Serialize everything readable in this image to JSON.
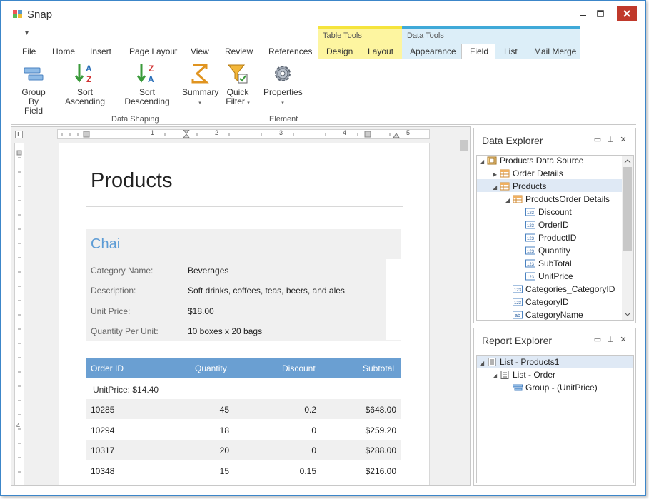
{
  "window": {
    "title": "Snap"
  },
  "ribbon": {
    "qat_arrow": "▾",
    "tabs": [
      "File",
      "Home",
      "Insert",
      "Page Layout",
      "View",
      "Review",
      "References",
      "Design",
      "Layout",
      "Appearance",
      "Field",
      "List",
      "Mail Merge"
    ],
    "active_tab": "Field",
    "context_groups": [
      {
        "label": "Table Tools",
        "color": "#fdf5a0",
        "bar": "#f5e43c"
      },
      {
        "label": "Data Tools",
        "color": "#dceef8",
        "bar": "#3fa9d8"
      }
    ],
    "buttons": [
      {
        "label": "Group By",
        "label2": "Field"
      },
      {
        "label": "Sort Ascending"
      },
      {
        "label": "Sort Descending"
      },
      {
        "label": "Summary",
        "arrow": "▾"
      },
      {
        "label": "Quick",
        "label2": "Filter",
        "arrow": "▾"
      },
      {
        "label": "Properties",
        "arrow": "▾"
      }
    ],
    "groups": [
      "Data Shaping",
      "Element"
    ]
  },
  "document": {
    "title": "Products",
    "product": {
      "name": "Chai",
      "fields": [
        {
          "label": "Category Name:",
          "value": "Beverages"
        },
        {
          "label": "Description:",
          "value": "Soft drinks, coffees, teas, beers, and ales"
        },
        {
          "label": "Unit Price:",
          "value": "$18.00"
        },
        {
          "label": "Quantity Per Unit:",
          "value": "10 boxes x 20 bags"
        }
      ]
    },
    "orders": {
      "headers": [
        "Order ID",
        "Quantity",
        "Discount",
        "Subtotal"
      ],
      "group_label": "UnitPrice: $14.40",
      "rows": [
        [
          "10285",
          "45",
          "0.2",
          "$648.00"
        ],
        [
          "10294",
          "18",
          "0",
          "$259.20"
        ],
        [
          "10317",
          "20",
          "0",
          "$288.00"
        ],
        [
          "10348",
          "15",
          "0.15",
          "$216.00"
        ]
      ]
    },
    "ruler_numbers": [
      "1",
      "2",
      "3",
      "4",
      "5"
    ],
    "ruler_vnumbers": [
      "4",
      "5"
    ]
  },
  "data_explorer": {
    "title": "Data Explorer",
    "items": [
      {
        "label": "Products Data Source"
      },
      {
        "label": "Order Details"
      },
      {
        "label": "Products"
      },
      {
        "label": "ProductsOrder Details"
      },
      {
        "label": "Discount",
        "badge": "123"
      },
      {
        "label": "OrderID",
        "badge": "123"
      },
      {
        "label": "ProductID",
        "badge": "123"
      },
      {
        "label": "Quantity",
        "badge": "123"
      },
      {
        "label": "SubTotal",
        "badge": "123"
      },
      {
        "label": "UnitPrice",
        "badge": "123"
      },
      {
        "label": "Categories_CategoryID",
        "badge": "123"
      },
      {
        "label": "CategoryID",
        "badge": "123"
      },
      {
        "label": "CategoryName",
        "badge": "ab"
      }
    ]
  },
  "report_explorer": {
    "title": "Report Explorer",
    "items": [
      {
        "label": "List - Products1"
      },
      {
        "label": "List - Order"
      },
      {
        "label": "Group - (UnitPrice)"
      }
    ]
  }
}
